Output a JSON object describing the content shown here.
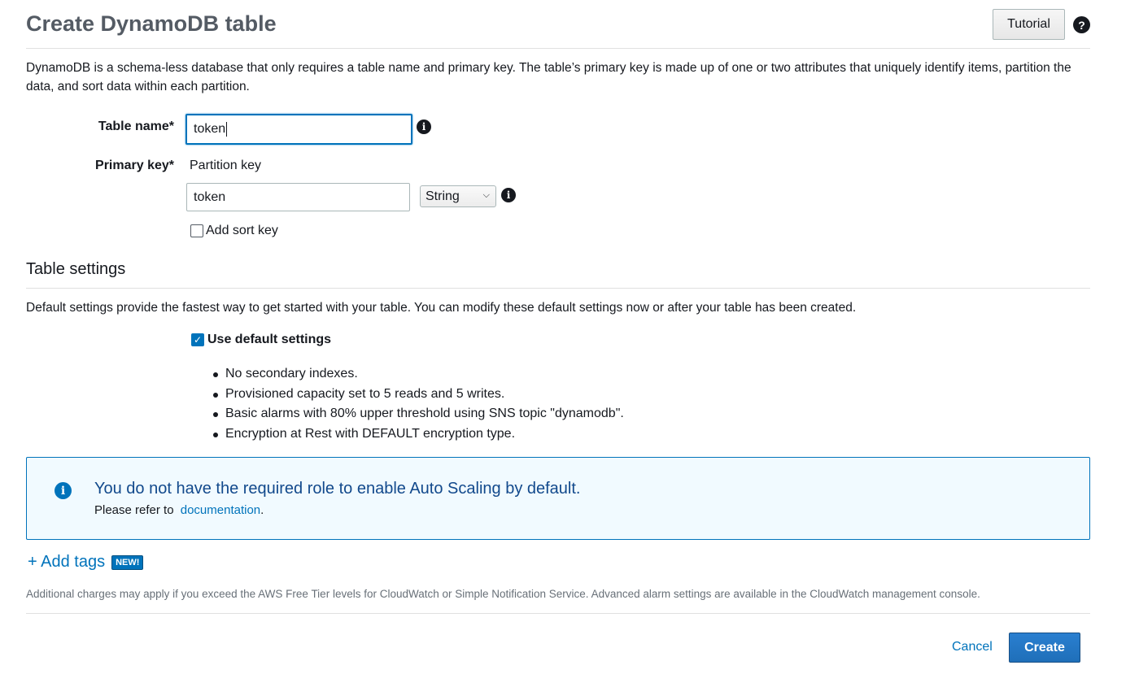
{
  "header": {
    "title": "Create DynamoDB table",
    "tutorial_label": "Tutorial",
    "help_icon": "question-circle-icon"
  },
  "intro": "DynamoDB is a schema-less database that only requires a table name and primary key. The table’s primary key is made up of one or two attributes that uniquely identify items, partition the data, and sort data within each partition.",
  "form": {
    "table_name_label": "Table name*",
    "table_name_value": "token",
    "primary_key_label": "Primary key*",
    "partition_key_label": "Partition key",
    "partition_key_value": "token",
    "partition_key_type": "String",
    "add_sort_key_label": "Add sort key",
    "add_sort_key_checked": false
  },
  "table_settings": {
    "title": "Table settings",
    "description": "Default settings provide the fastest way to get started with your table. You can modify these default settings now or after your table has been created.",
    "use_default_label": "Use default settings",
    "use_default_checked": true,
    "bullets": [
      "No secondary indexes.",
      "Provisioned capacity set to 5 reads and 5 writes.",
      "Basic alarms with 80% upper threshold using SNS topic \"dynamodb\".",
      "Encryption at Rest with DEFAULT encryption type."
    ]
  },
  "alert": {
    "icon": "info-circle-icon",
    "title": "You do not have the required role to enable Auto Scaling by default.",
    "body_prefix": "Please refer to",
    "link_text": "documentation",
    "body_suffix": "."
  },
  "tags": {
    "add_label": "+ Add tags",
    "badge": "NEW!"
  },
  "footnote": "Additional charges may apply if you exceed the AWS Free Tier levels for CloudWatch or Simple Notification Service. Advanced alarm settings are available in the CloudWatch management console.",
  "actions": {
    "cancel_label": "Cancel",
    "create_label": "Create"
  },
  "colors": {
    "accent": "#0073bb",
    "alert_bg": "#f1faff",
    "alert_title": "#12498c"
  }
}
